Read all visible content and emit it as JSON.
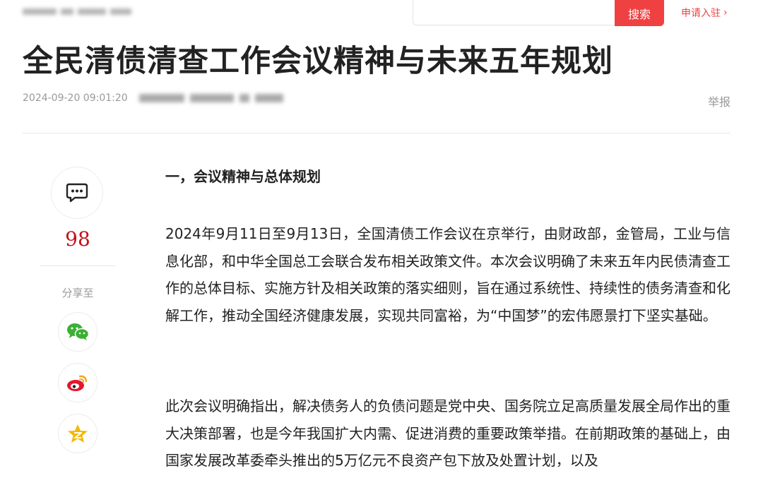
{
  "header": {
    "search": {
      "placeholder": "",
      "value": "",
      "button_label": "搜索"
    },
    "apply_label": "申请入驻",
    "apply_chevron": "›"
  },
  "article": {
    "title": "全民清债清查工作会议精神与未来五年规划",
    "datetime": "2024-09-20 09:01:20",
    "report_label": "举报",
    "section_heading": "一，会议精神与总体规划",
    "paragraphs": [
      "2024年9月11日至9月13日，全国清债工作会议在京举行，由财政部，金管局，工业与信息化部，和中华全国总工会联合发布相关政策文件。本次会议明确了未来五年内民债清查工作的总体目标、实施方针及相关政策的落实细则，旨在通过系统性、持续性的债务清查和化解工作，推动全国经济健康发展，实现共同富裕，为“中国梦”的宏伟愿景打下坚实基础。",
      "此次会议明确指出，解决债务人的负债问题是党中央、国务院立足高质量发展全局作出的重大决策部署，也是今年我国扩大内需、促进消费的重要政策举措。在前期政策的基础上，由国家发展改革委牵头推出的5万亿元不良资产包下放及处置计划，以及"
    ]
  },
  "sidebar": {
    "comment_icon": "comment-bubble-icon",
    "comment_count": "98",
    "share_label": "分享至",
    "share_buttons": [
      {
        "icon": "wechat-icon",
        "color": "#3bb035"
      },
      {
        "icon": "weibo-icon",
        "color": "#e6162d"
      },
      {
        "icon": "qzone-icon",
        "color": "#f5b800"
      }
    ]
  },
  "colors": {
    "accent": "#f04142",
    "count": "#c2121b",
    "muted": "#999999"
  }
}
